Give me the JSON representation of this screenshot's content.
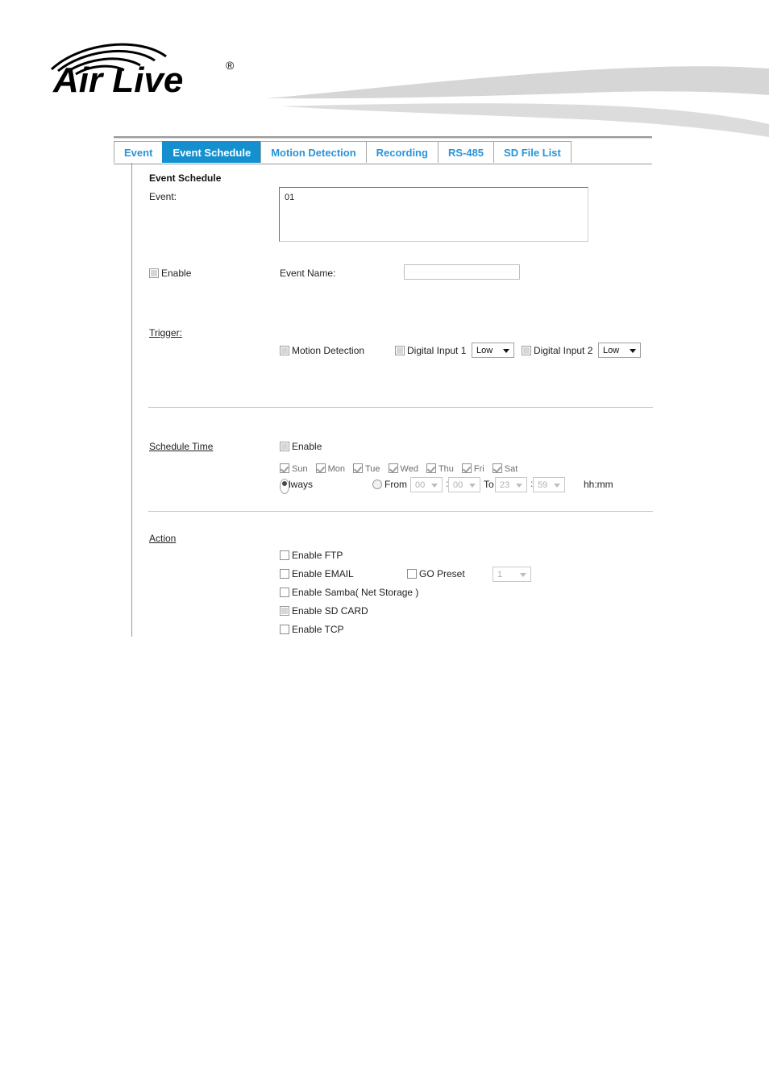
{
  "brand": {
    "logo_text": "Air Live",
    "logo_trademark": "®"
  },
  "tabs": [
    {
      "label": "Event",
      "active": false
    },
    {
      "label": "Event Schedule",
      "active": true
    },
    {
      "label": "Motion Detection",
      "active": false
    },
    {
      "label": "Recording",
      "active": false
    },
    {
      "label": "RS-485",
      "active": false
    },
    {
      "label": "SD File List",
      "active": false
    }
  ],
  "page": {
    "section_title": "Event Schedule",
    "event_label": "Event:",
    "event_list": [
      "01"
    ],
    "enable_label": "Enable",
    "event_name_label": "Event Name:",
    "event_name_value": ""
  },
  "trigger": {
    "title": "Trigger:",
    "motion_detection_label": "Motion Detection",
    "digital_input_1_label": "Digital Input 1",
    "digital_input_1_value": "Low",
    "digital_input_2_label": "Digital Input 2",
    "digital_input_2_value": "Low"
  },
  "schedule_time": {
    "title": "Schedule Time",
    "enable_label": "Enable",
    "days": [
      "Sun",
      "Mon",
      "Tue",
      "Wed",
      "Thu",
      "Fri",
      "Sat"
    ],
    "always_label": "Always",
    "from_label": "From",
    "to_label": "To",
    "from_hour": "00",
    "from_minute": "00",
    "to_hour": "23",
    "to_minute": "59",
    "format_hint": "hh:mm",
    "colon": ":"
  },
  "action": {
    "title": "Action",
    "enable_ftp_label": "Enable FTP",
    "enable_email_label": "Enable EMAIL",
    "go_preset_label": "GO Preset",
    "go_preset_value": "1",
    "enable_samba_label": "Enable Samba( Net Storage )",
    "enable_sd_card_label": "Enable SD CARD",
    "enable_tcp_label": "Enable TCP"
  },
  "colors": {
    "accent_blue": "#1590cf",
    "tab_text_blue": "#2a93d8",
    "swoosh_gray": "#d4d4d4",
    "border_gray": "#9a9a9a"
  }
}
